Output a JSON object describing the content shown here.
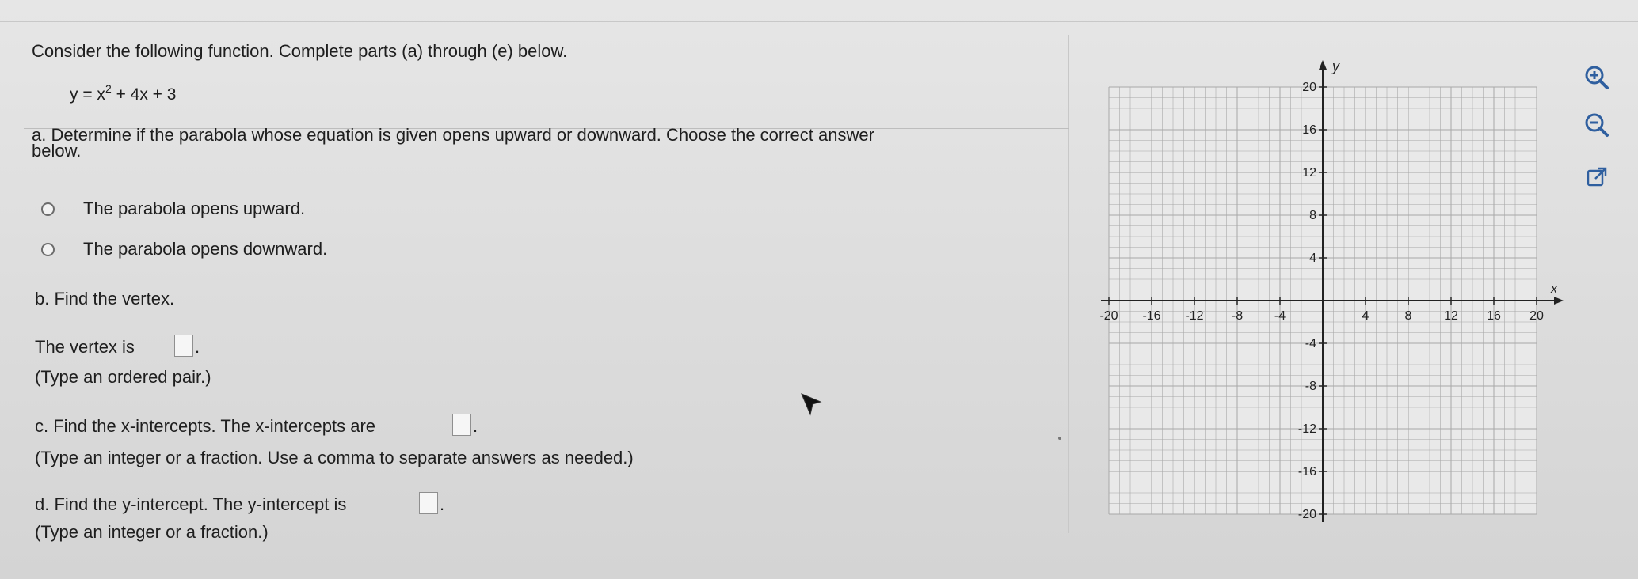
{
  "question": {
    "intro": "Consider the following function. Complete parts (a) through (e) below.",
    "function_prefix": "y = x",
    "function_exponent": "2",
    "function_suffix": " + 4x + 3",
    "part_a": {
      "line1": "a. Determine if the parabola whose equation is given opens upward or downward. Choose the correct answer",
      "line2": "below.",
      "options": [
        "The parabola opens upward.",
        "The parabola opens downward."
      ]
    },
    "part_b": {
      "prompt": "b. Find the vertex.",
      "answer_label": "The vertex is",
      "hint": "(Type an ordered pair.)"
    },
    "part_c": {
      "prompt": "c. Find the x-intercepts. The x-intercepts are",
      "hint": "(Type an integer or a fraction. Use a comma to separate answers as needed.)"
    },
    "part_d": {
      "prompt": "d. Find the y-intercept. The y-intercept is",
      "hint": "(Type an integer or a fraction.)"
    },
    "period": "."
  },
  "graph": {
    "x_axis_label": "x",
    "y_axis_label": "y",
    "x_range": [
      -20,
      20
    ],
    "y_range": [
      -20,
      20
    ],
    "grid_step": 1,
    "x_ticks": [
      "-20",
      "-16",
      "-12",
      "-8",
      "-4",
      "4",
      "8",
      "12",
      "16",
      "20"
    ],
    "y_ticks": [
      "20",
      "16",
      "12",
      "8",
      "4",
      "-4",
      "-8",
      "-12",
      "-16",
      "-20"
    ],
    "grid_color": "#a8a8a8"
  },
  "tools": {
    "icons": [
      "zoom-in-icon",
      "zoom-out-icon",
      "popout-icon"
    ],
    "accent_color": "#2f5f9f"
  }
}
